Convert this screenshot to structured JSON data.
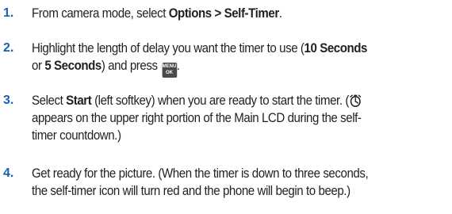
{
  "steps": [
    {
      "number": "1.",
      "parts": {
        "a": "From camera mode, select ",
        "b": "Options > Self-Timer",
        "c": "."
      }
    },
    {
      "number": "2.",
      "parts": {
        "a": "Highlight the length of delay you want the timer to use (",
        "b": "10 Seconds",
        "c": "or ",
        "d": "5 Seconds",
        "e": ") and press ",
        "f": "."
      }
    },
    {
      "number": "3.",
      "parts": {
        "a": "Select ",
        "b": "Start",
        "c": " (left softkey) when you are ready to start the timer. (",
        "d": "appears on the upper right portion of the Main LCD during the self-",
        "e": "timer countdown.)"
      }
    },
    {
      "number": "4.",
      "parts": {
        "a": "Get ready for the picture. (When the timer is down to three seconds,",
        "b": "the self-timer icon will turn red and the phone will begin to beep.)"
      }
    }
  ],
  "icons": {
    "menu_ok_key": {
      "name": "menu-ok-key-icon",
      "top_label": "MENU",
      "bottom_label": "OK"
    },
    "self_timer": {
      "name": "self-timer-icon"
    }
  },
  "colors": {
    "step_number": "#1a5fb4",
    "text": "#231f20",
    "key_background": "#4a4a4a"
  }
}
